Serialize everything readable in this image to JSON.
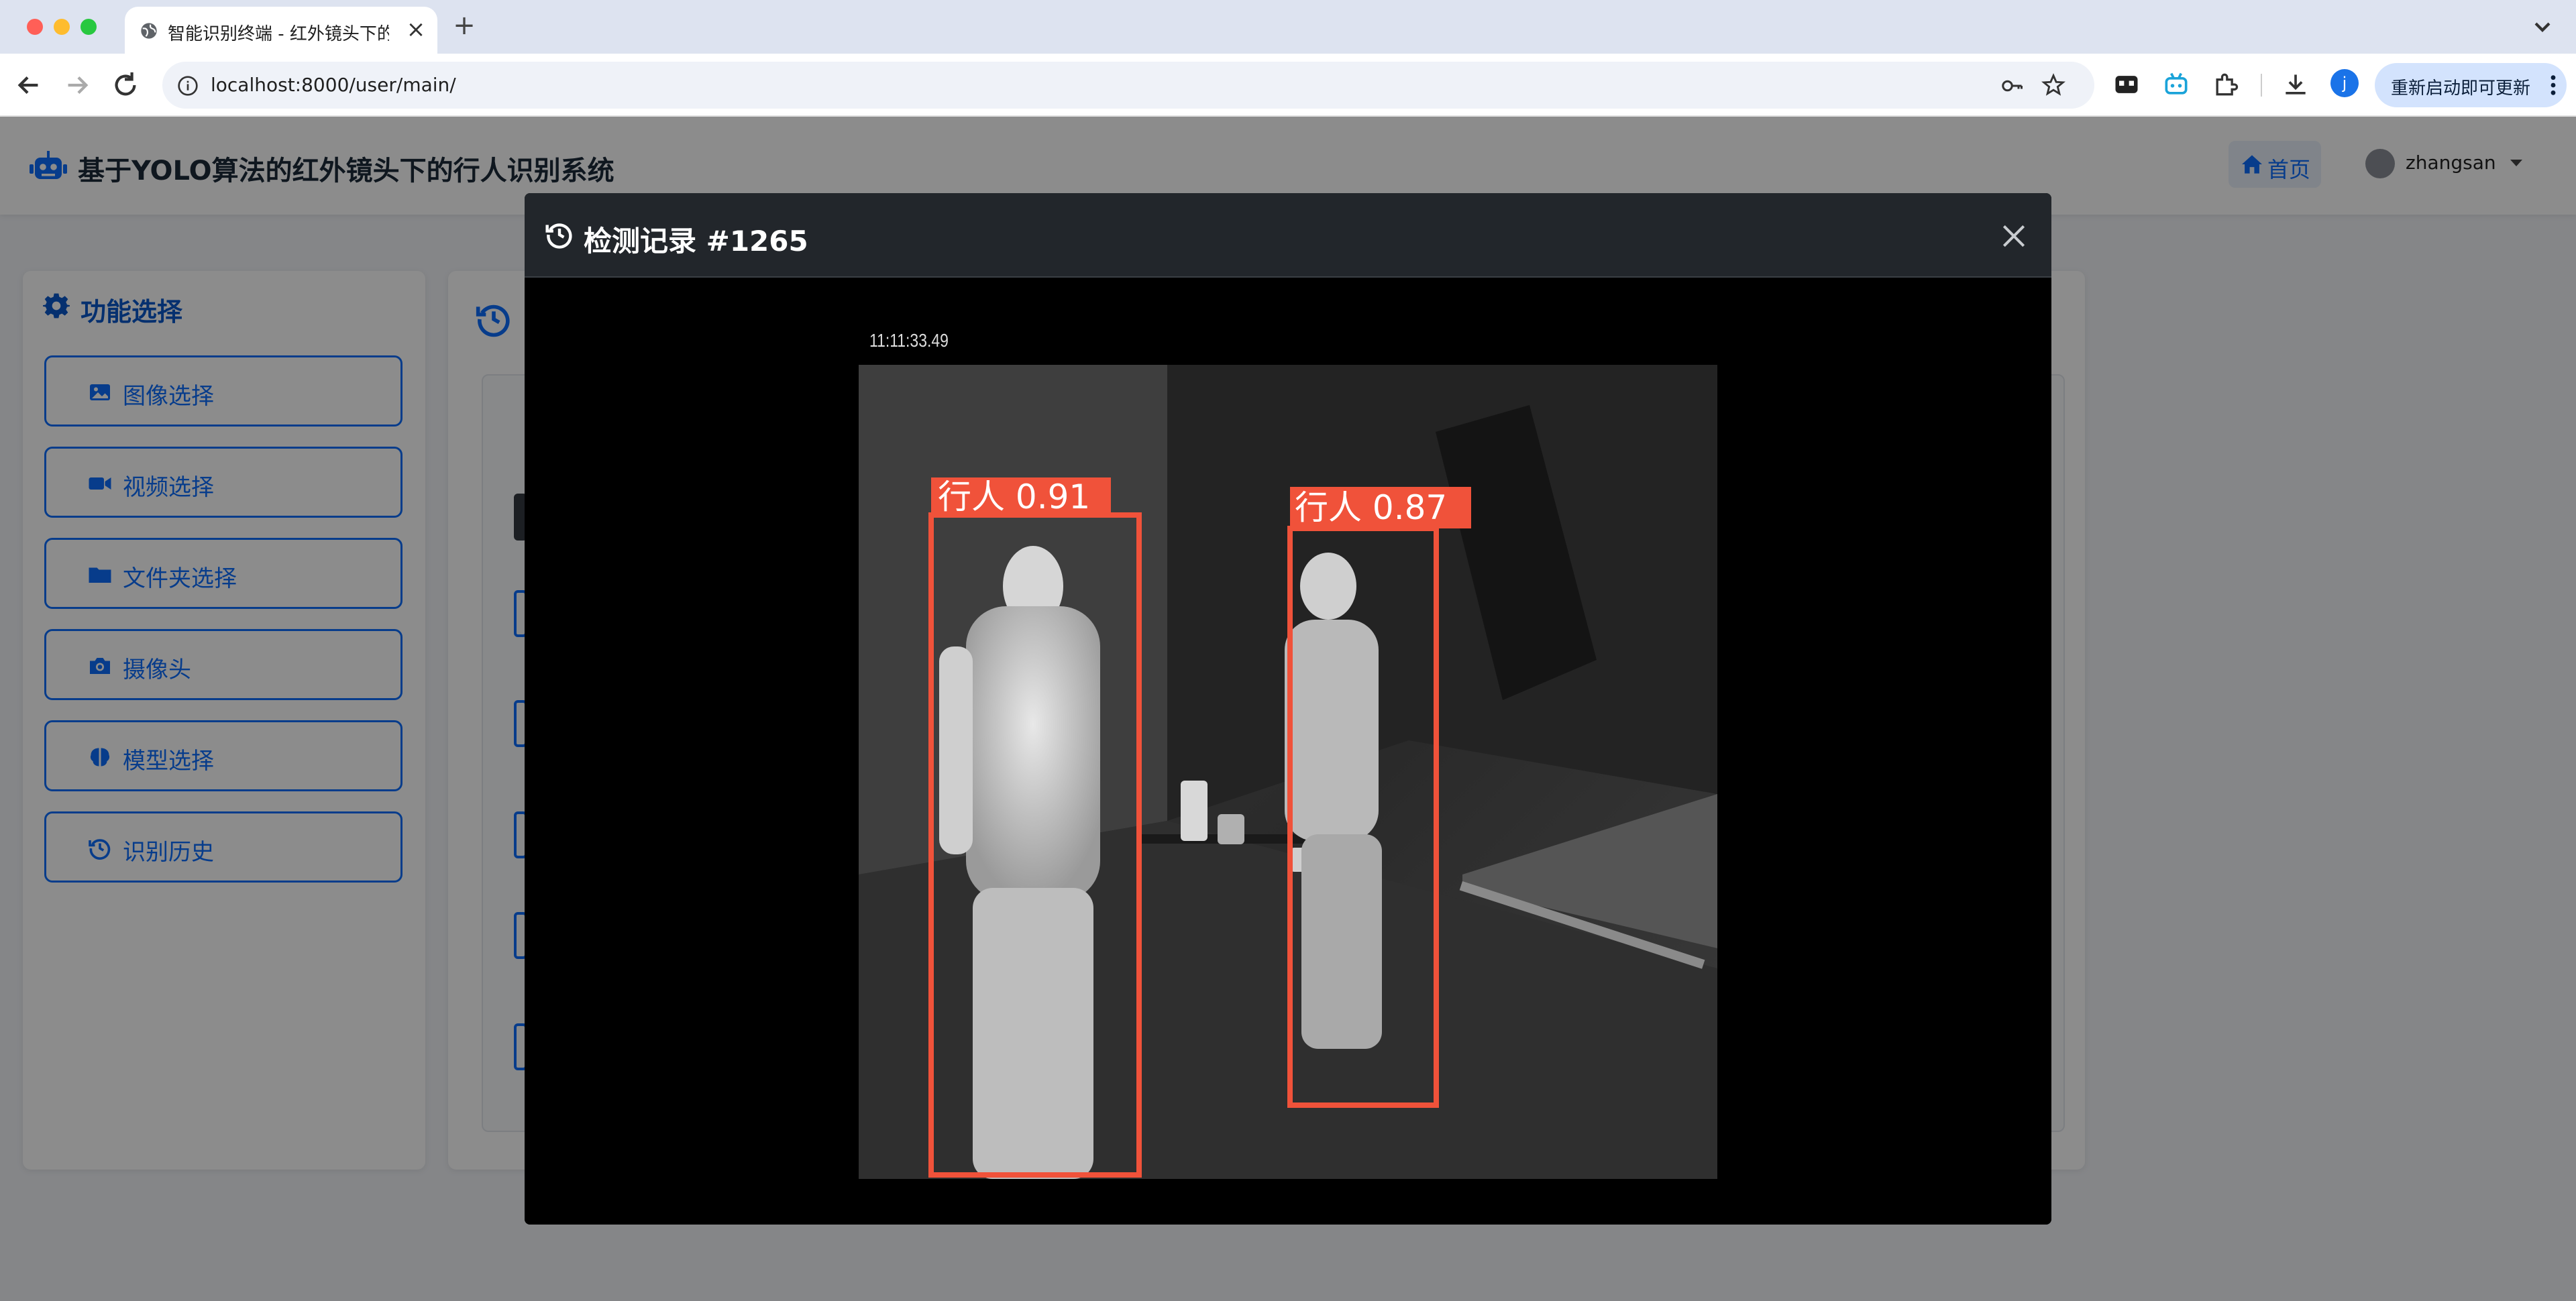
{
  "browser": {
    "tab_title": "智能识别终端 - 红外镜头下的行",
    "url": "localhost:8000/user/main/",
    "profile_initial": "j",
    "update_label": "重新启动即可更新"
  },
  "app": {
    "title": "基于YOLO算法的红外镜头下的行人识别系统",
    "home_label": "首页",
    "username": "zhangsan"
  },
  "function_panel": {
    "title": "功能选择",
    "buttons": [
      {
        "label": "图像选择",
        "icon": "image-icon"
      },
      {
        "label": "视频选择",
        "icon": "video-camera-icon"
      },
      {
        "label": "文件夹选择",
        "icon": "folder-icon"
      },
      {
        "label": "摄像头",
        "icon": "camera-icon"
      },
      {
        "label": "模型选择",
        "icon": "brain-icon"
      },
      {
        "label": "识别历史",
        "icon": "history-icon"
      }
    ]
  },
  "modal": {
    "title": "检测记录 #1265",
    "image": {
      "timestamp": "11:11:33.49",
      "detections": [
        {
          "label": "行人 0.91",
          "class": "行人",
          "confidence": 0.91
        },
        {
          "label": "行人 0.87",
          "class": "行人",
          "confidence": 0.87
        }
      ],
      "box_color": "#f0523a"
    }
  },
  "colors": {
    "primary": "#0d6efd",
    "modal_header": "#22262b"
  }
}
